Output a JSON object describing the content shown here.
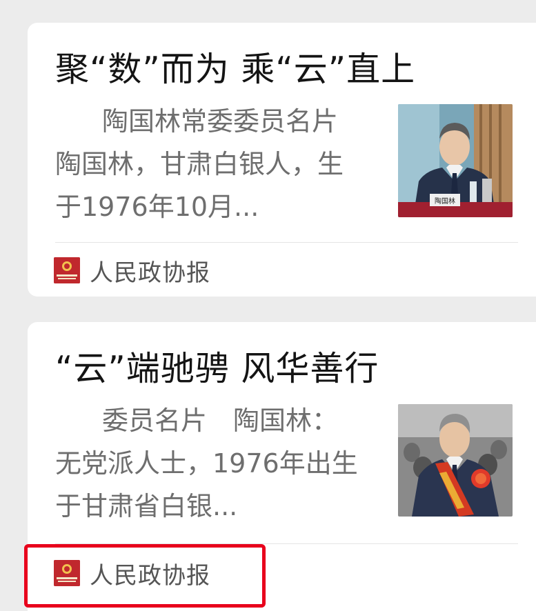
{
  "articles": [
    {
      "title": "聚“数”而为 乘“云”直上",
      "summary": "陶国林常委委员名片 陶国林，甘肃白银人，生于1976年10月...",
      "source": "人民政协报",
      "thumbnail_label": "陶国林"
    },
    {
      "title": "“云”端驰骋 风华善行",
      "summary": "委员名片　陶国林：无党派人士，1976年出生于甘肃省白银...",
      "source": "人民政协报"
    }
  ],
  "colors": {
    "page_background": "#ececec",
    "card_background": "#ffffff",
    "brand_red": "#c0282d",
    "highlight_red": "#e8001c"
  },
  "icons": {
    "source_logo": "people-cppcc-daily-logo-icon"
  }
}
